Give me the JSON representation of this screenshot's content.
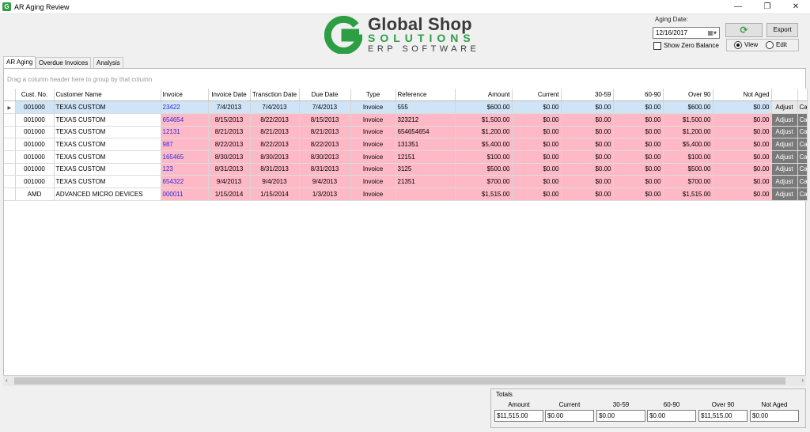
{
  "window": {
    "title": "AR Aging Review",
    "minimize": "—",
    "restore": "❐",
    "close": "✕"
  },
  "logo": {
    "line1": "Global Shop",
    "line2": "SOLUTIONS",
    "line3": "ERP SOFTWARE",
    "brand_green": "#2e9e44"
  },
  "controls": {
    "aging_date_label": "Aging Date:",
    "aging_date_value": "12/16/2017",
    "show_zero_balance_label": "Show Zero Balance",
    "export_label": "Export",
    "view_label": "View",
    "edit_label": "Edit",
    "refresh_icon": "refresh-icon"
  },
  "tabs": [
    {
      "label": "AR Aging"
    },
    {
      "label": "Overdue Invoices"
    },
    {
      "label": "Analysis"
    }
  ],
  "grid": {
    "group_hint": "Drag a column header here to group by that column",
    "columns": [
      "Cust. No.",
      "Customer Name",
      "Invoice",
      "Invoice Date",
      "Transction Date",
      "Due Date",
      "Type",
      "Reference",
      "Amount",
      "Current",
      "30-59",
      "60-90",
      "Over 90",
      "Not Aged"
    ],
    "rows": [
      {
        "cust": "001000",
        "name": "TEXAS CUSTOM",
        "invoice": "23422",
        "inv_date": "7/4/2013",
        "trans_date": "7/4/2013",
        "due_date": "7/4/2013",
        "type": "Invoice",
        "reference": "555",
        "amount": "$600.00",
        "current": "$0.00",
        "d3059": "$0.00",
        "d6090": "$0.00",
        "over90": "$600.00",
        "notaged": "$0.00",
        "btn1": "Adjust",
        "btn2": "Cash"
      },
      {
        "cust": "001000",
        "name": "TEXAS CUSTOM",
        "invoice": "654654",
        "inv_date": "8/15/2013",
        "trans_date": "8/22/2013",
        "due_date": "8/15/2013",
        "type": "Invoice",
        "reference": "323212",
        "amount": "$1,500.00",
        "current": "$0.00",
        "d3059": "$0.00",
        "d6090": "$0.00",
        "over90": "$1,500.00",
        "notaged": "$0.00",
        "btn1": "Adjust",
        "btn2": "Cash"
      },
      {
        "cust": "001000",
        "name": "TEXAS CUSTOM",
        "invoice": "12131",
        "inv_date": "8/21/2013",
        "trans_date": "8/21/2013",
        "due_date": "8/21/2013",
        "type": "Invoice",
        "reference": "654654654",
        "amount": "$1,200.00",
        "current": "$0.00",
        "d3059": "$0.00",
        "d6090": "$0.00",
        "over90": "$1,200.00",
        "notaged": "$0.00",
        "btn1": "Adjust",
        "btn2": "Cash"
      },
      {
        "cust": "001000",
        "name": "TEXAS CUSTOM",
        "invoice": "987",
        "inv_date": "8/22/2013",
        "trans_date": "8/22/2013",
        "due_date": "8/22/2013",
        "type": "Invoice",
        "reference": "131351",
        "amount": "$5,400.00",
        "current": "$0.00",
        "d3059": "$0.00",
        "d6090": "$0.00",
        "over90": "$5,400.00",
        "notaged": "$0.00",
        "btn1": "Adjust",
        "btn2": "Cash"
      },
      {
        "cust": "001000",
        "name": "TEXAS CUSTOM",
        "invoice": "165465",
        "inv_date": "8/30/2013",
        "trans_date": "8/30/2013",
        "due_date": "8/30/2013",
        "type": "Invoice",
        "reference": "12151",
        "amount": "$100.00",
        "current": "$0.00",
        "d3059": "$0.00",
        "d6090": "$0.00",
        "over90": "$100.00",
        "notaged": "$0.00",
        "btn1": "Adjust",
        "btn2": "Cash"
      },
      {
        "cust": "001000",
        "name": "TEXAS CUSTOM",
        "invoice": "123",
        "inv_date": "8/31/2013",
        "trans_date": "8/31/2013",
        "due_date": "8/31/2013",
        "type": "Invoice",
        "reference": "3125",
        "amount": "$500.00",
        "current": "$0.00",
        "d3059": "$0.00",
        "d6090": "$0.00",
        "over90": "$500.00",
        "notaged": "$0.00",
        "btn1": "Adjust",
        "btn2": "Cash"
      },
      {
        "cust": "001000",
        "name": "TEXAS CUSTOM",
        "invoice": "654322",
        "inv_date": "9/4/2013",
        "trans_date": "9/4/2013",
        "due_date": "9/4/2013",
        "type": "Invoice",
        "reference": "21351",
        "amount": "$700.00",
        "current": "$0.00",
        "d3059": "$0.00",
        "d6090": "$0.00",
        "over90": "$700.00",
        "notaged": "$0.00",
        "btn1": "Adjust",
        "btn2": "Cash"
      },
      {
        "cust": "AMD",
        "name": "ADVANCED MICRO DEVICES",
        "invoice": "000011",
        "inv_date": "1/15/2014",
        "trans_date": "1/15/2014",
        "due_date": "1/3/2013",
        "type": "Invoice",
        "reference": "",
        "amount": "$1,515.00",
        "current": "$0.00",
        "d3059": "$0.00",
        "d6090": "$0.00",
        "over90": "$1,515.00",
        "notaged": "$0.00",
        "btn1": "Adjust",
        "btn2": "Cash"
      }
    ],
    "colors": {
      "row_pink": "#ffb8c6",
      "row_selected": "#cfe4f7",
      "hdr_3059": "#ffffcc",
      "hdr_6090": "#ffa07a",
      "hdr_over90": "#ffb6c1",
      "hdr_not_aged": "#b0c4de"
    }
  },
  "totals": {
    "title": "Totals",
    "labels": [
      "Amount",
      "Current",
      "30-59",
      "60-90",
      "Over 90",
      "Not Aged"
    ],
    "values": [
      "$11,515.00",
      "$0.00",
      "$0.00",
      "$0.00",
      "$11,515.00",
      "$0.00"
    ]
  }
}
